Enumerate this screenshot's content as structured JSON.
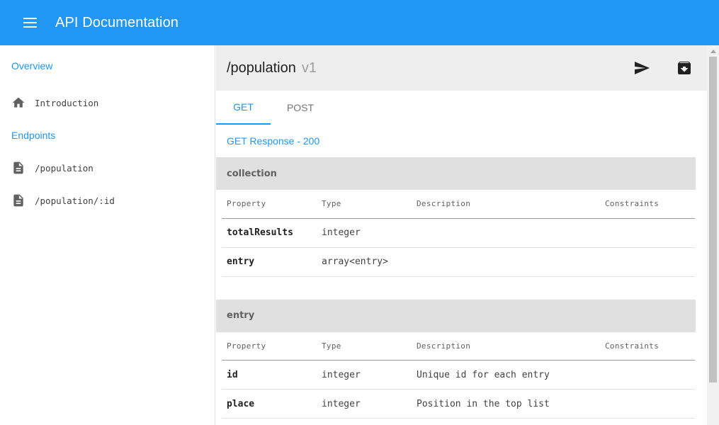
{
  "app": {
    "title": "API Documentation",
    "accent": "#2196f3"
  },
  "sidebar": {
    "sections": [
      {
        "label": "Overview",
        "items": [
          {
            "label": "Introduction",
            "icon": "home-icon"
          }
        ]
      },
      {
        "label": "Endpoints",
        "items": [
          {
            "label": "/population",
            "icon": "document-icon"
          },
          {
            "label": "/population/:id",
            "icon": "document-icon"
          }
        ]
      }
    ]
  },
  "resource": {
    "path": "/population",
    "version": "v1",
    "actions": {
      "send": "send-icon",
      "archive": "archive-icon"
    }
  },
  "tabs": [
    {
      "label": "GET",
      "active": true
    },
    {
      "label": "POST",
      "active": false
    }
  ],
  "response": {
    "title": "GET Response - 200",
    "columns": [
      "Property",
      "Type",
      "Description",
      "Constraints"
    ],
    "blocks": [
      {
        "name": "collection",
        "rows": [
          {
            "property": "totalResults",
            "type": "integer",
            "description": "",
            "constraints": ""
          },
          {
            "property": "entry",
            "type": "array<entry>",
            "description": "",
            "constraints": ""
          }
        ]
      },
      {
        "name": "entry",
        "rows": [
          {
            "property": "id",
            "type": "integer",
            "description": "Unique id for each entry",
            "constraints": ""
          },
          {
            "property": "place",
            "type": "integer",
            "description": "Position in the top list",
            "constraints": ""
          }
        ]
      }
    ]
  }
}
